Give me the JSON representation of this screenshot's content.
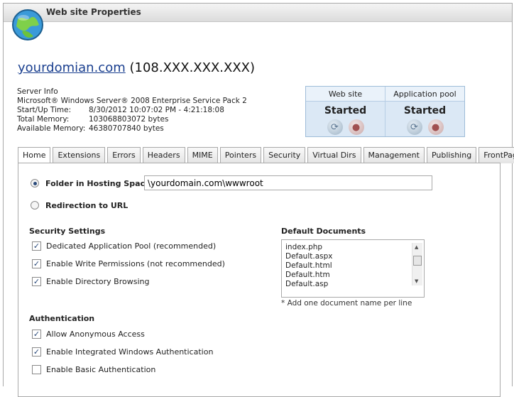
{
  "window": {
    "title": "Web site Properties"
  },
  "site": {
    "domain": "yourdomian.com",
    "ip": "(108.XXX.XXX.XXX)"
  },
  "server_info": {
    "heading": "Server Info",
    "os": "Microsoft® Windows Server® 2008 Enterprise Service Pack 2",
    "rows": [
      {
        "label": "Start/Up Time:",
        "value": "8/30/2012 10:07:02 PM - 4:21:18:08"
      },
      {
        "label": "Total Memory:",
        "value": "103068803072 bytes"
      },
      {
        "label": "Available Memory:",
        "value": "46380707840 bytes"
      }
    ]
  },
  "status": {
    "website": {
      "label": "Web site",
      "state": "Started"
    },
    "app_pool": {
      "label": "Application pool",
      "state": "Started"
    }
  },
  "tabs": [
    "Home",
    "Extensions",
    "Errors",
    "Headers",
    "MIME",
    "Pointers",
    "Security",
    "Virtual Dirs",
    "Management",
    "Publishing",
    "FrontPage"
  ],
  "home": {
    "folder_label": "Folder in Hosting Space",
    "folder_value": "\\yourdomain.com\\wwwroot",
    "redirect_label": "Redirection to URL",
    "security_heading": "Security Settings",
    "security": [
      {
        "label": "Dedicated Application Pool (recommended)",
        "checked": true
      },
      {
        "label": "Enable Write Permissions (not recommended)",
        "checked": true
      },
      {
        "label": "Enable Directory Browsing",
        "checked": true
      }
    ],
    "auth_heading": "Authentication",
    "auth": [
      {
        "label": "Allow Anonymous Access",
        "checked": true
      },
      {
        "label": "Enable Integrated Windows Authentication",
        "checked": true
      },
      {
        "label": "Enable Basic Authentication",
        "checked": false
      }
    ],
    "default_docs_heading": "Default Documents",
    "default_docs": [
      "index.php",
      "Default.aspx",
      "Default.html",
      "Default.htm",
      "Default.asp"
    ],
    "default_docs_note": "* Add one document name per line"
  },
  "colors": {
    "link": "#1a3f8f",
    "status_panel": "#dbe8f5"
  }
}
